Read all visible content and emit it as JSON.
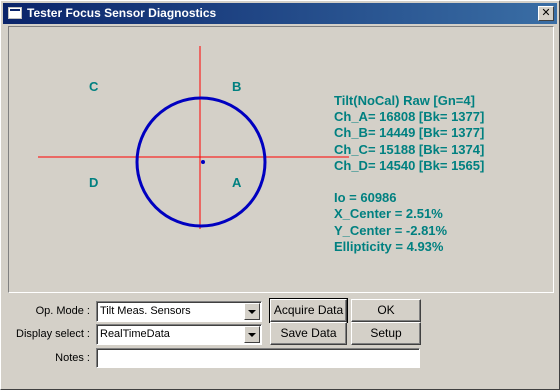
{
  "window": {
    "title": "Tester Focus Sensor Diagnostics",
    "close_glyph": "✕"
  },
  "plot": {
    "quadrants": {
      "a": "A",
      "b": "B",
      "c": "C",
      "d": "D"
    },
    "colors": {
      "crosshair": "#ff0000",
      "circle": "#0000c0",
      "text": "#008080"
    }
  },
  "readout": {
    "header": "Tilt(NoCal) Raw [Gn=4]",
    "channels": [
      "Ch_A=  16808 [Bk= 1377]",
      "Ch_B=  14449 [Bk= 1377]",
      "Ch_C=  15188 [Bk= 1374]",
      "Ch_D=  14540 [Bk= 1565]"
    ],
    "io": "Io = 60986",
    "x_center": "X_Center = 2.51%",
    "y_center": "Y_Center = -2.81%",
    "ellipticity": "Ellipticity = 4.93%"
  },
  "controls": {
    "op_mode_label": "Op. Mode :",
    "op_mode_value": "Tilt Meas. Sensors",
    "display_label": "Display select :",
    "display_value": "RealTimeData",
    "notes_label": "Notes :",
    "notes_value": ""
  },
  "buttons": {
    "acquire": "Acquire Data",
    "ok": "OK",
    "save": "Save Data",
    "setup": "Setup"
  }
}
